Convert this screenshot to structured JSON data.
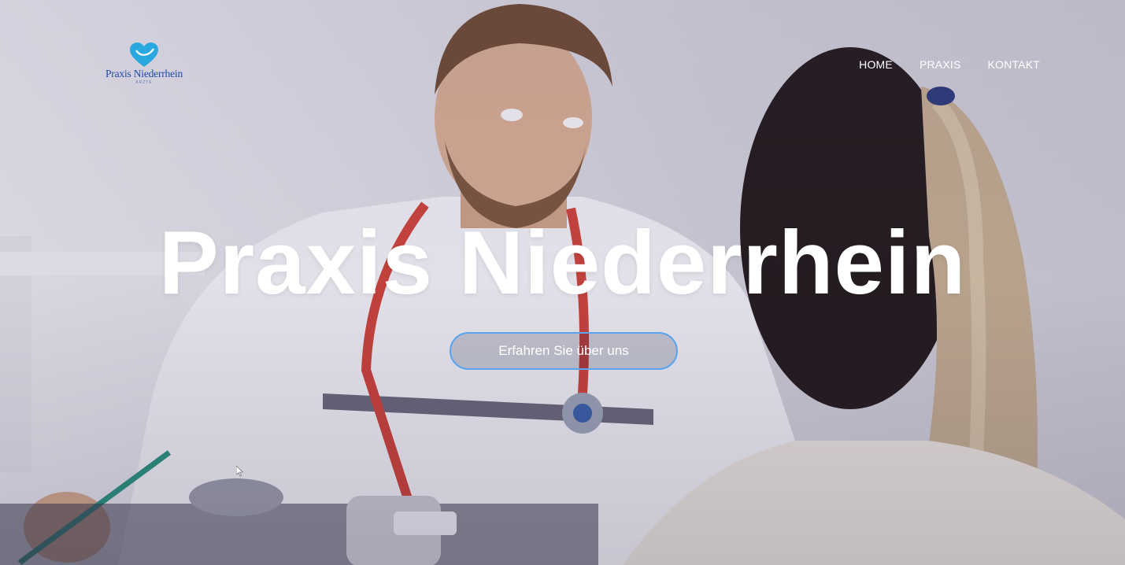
{
  "header": {
    "logo_text": "Praxis Niederrhein",
    "logo_subtext": "ARZTE",
    "nav": [
      {
        "label": "HOME"
      },
      {
        "label": "PRAXIS"
      },
      {
        "label": "KONTAKT"
      }
    ]
  },
  "hero": {
    "title": "Praxis Niederrhein",
    "cta_label": "Erfahren Sie über uns"
  },
  "colors": {
    "brand_blue": "#1f4aa8",
    "logo_cyan": "#29a8e0",
    "cta_border": "#5aa4f0"
  },
  "icons": {
    "logo": "heart-logo-icon",
    "pointer": "mouse-pointer-icon"
  }
}
